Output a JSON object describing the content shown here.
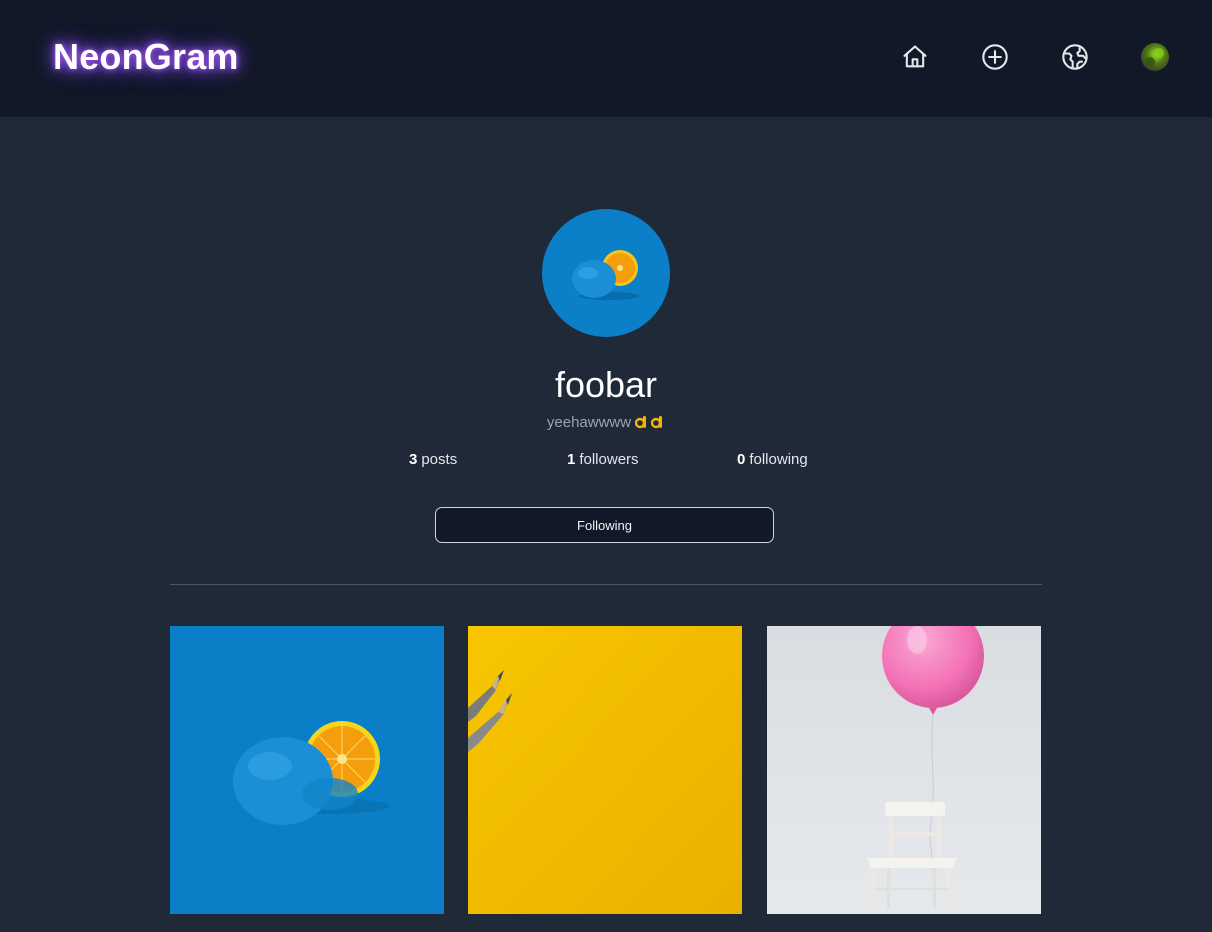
{
  "app": {
    "logo": "NeonGram",
    "nav": [
      {
        "name": "home-icon"
      },
      {
        "name": "plus-circle-icon"
      },
      {
        "name": "globe-icon"
      },
      {
        "name": "avatar"
      }
    ],
    "accent_color": "#8b5cf6"
  },
  "profile": {
    "username": "foobar",
    "bio": "yeehawwww",
    "bio_emoji": "ok-hand-icon ×2",
    "stats": {
      "posts_count": "3",
      "posts_label": "posts",
      "followers_count": "1",
      "followers_label": "followers",
      "following_count": "0",
      "following_label": "following"
    },
    "follow_button_label": "Following"
  },
  "posts": [
    {
      "name": "post-blue-orange"
    },
    {
      "name": "post-yellow-pencils"
    },
    {
      "name": "post-balloon-chair"
    }
  ]
}
